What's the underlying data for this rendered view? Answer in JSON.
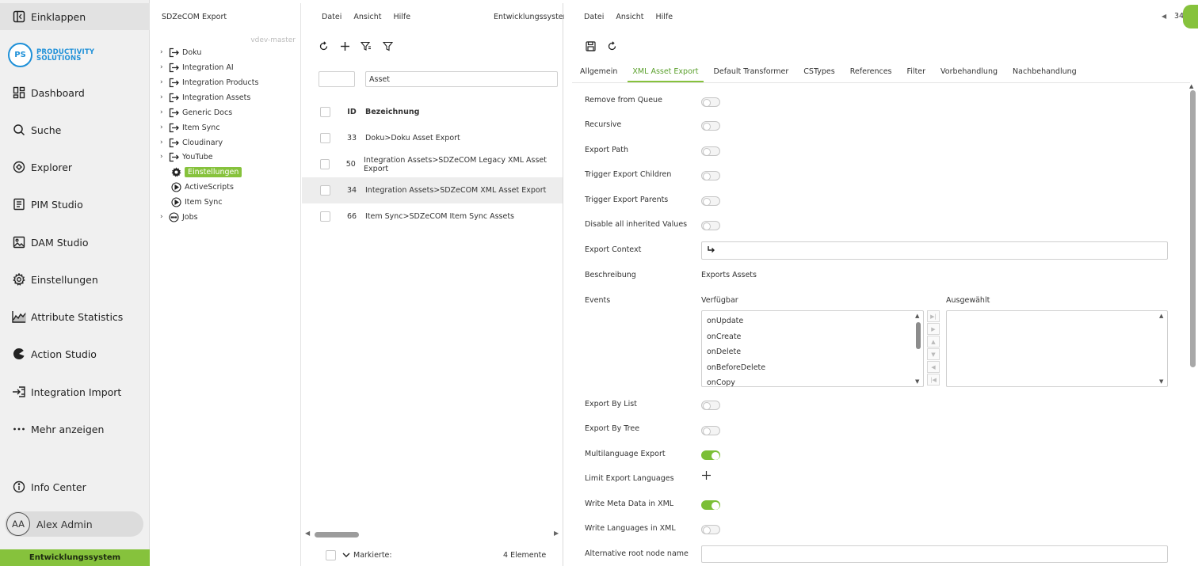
{
  "nav": {
    "collapse": "Einklappen",
    "logo_mark": "PS",
    "logo_line1": "PRODUCTIVITY",
    "logo_line2": "SOLUTIONS",
    "items": [
      "Dashboard",
      "Suche",
      "Explorer",
      "PIM Studio",
      "DAM Studio",
      "Einstellungen",
      "Attribute Statistics",
      "Action Studio",
      "Integration Import",
      "Mehr anzeigen"
    ],
    "info_center": "Info Center",
    "user_initials": "AA",
    "user_name": "Alex Admin",
    "env": "Entwicklungssystem"
  },
  "tree": {
    "title": "SDZeCOM Export",
    "branch": "vdev-master",
    "items": [
      "Doku",
      "Integration AI",
      "Integration Products",
      "Integration Assets",
      "Generic Docs",
      "Item Sync",
      "Cloudinary",
      "YouTube"
    ],
    "children": [
      "Einstellungen",
      "ActiveScripts",
      "Item Sync"
    ],
    "jobs": "Jobs"
  },
  "list": {
    "menu": [
      "Datei",
      "Ansicht",
      "Hilfe"
    ],
    "env": "Entwicklungssystem",
    "search_value": "Asset",
    "col_id": "ID",
    "col_name": "Bezeichnung",
    "rows": [
      {
        "id": "33",
        "name": "Doku>Doku Asset Export"
      },
      {
        "id": "50",
        "name": "Integration Assets>SDZeCOM Legacy XML Asset Export"
      },
      {
        "id": "34",
        "name": "Integration Assets>SDZeCOM XML Asset Export"
      },
      {
        "id": "66",
        "name": "Item Sync>SDZeCOM Item Sync Assets"
      }
    ],
    "footer_label": "Markierte:",
    "footer_count": "4 Elemente"
  },
  "detail": {
    "menu": [
      "Datei",
      "Ansicht",
      "Hilfe"
    ],
    "record_id": "34",
    "tabs": [
      "Allgemein",
      "XML Asset Export",
      "Default Transformer",
      "CSTypes",
      "References",
      "Filter",
      "Vorbehandlung",
      "Nachbehandlung"
    ],
    "fields": {
      "remove_from_queue": "Remove from Queue",
      "recursive": "Recursive",
      "export_path": "Export Path",
      "trigger_children": "Trigger Export Children",
      "trigger_parents": "Trigger Export Parents",
      "disable_inherited": "Disable all inherited Values",
      "export_context": "Export Context",
      "beschreibung": "Beschreibung",
      "beschreibung_value": "Exports Assets",
      "events": "Events",
      "available": "Verfügbar",
      "selected": "Ausgewählt",
      "export_by_list": "Export By List",
      "export_by_tree": "Export By Tree",
      "multilanguage": "Multilanguage Export",
      "limit_languages": "Limit Export Languages",
      "write_meta": "Write Meta Data in XML",
      "write_languages": "Write Languages in XML",
      "alt_root": "Alternative root node name"
    },
    "event_options": [
      "onUpdate",
      "onCreate",
      "onDelete",
      "onBeforeDelete",
      "onCopy"
    ],
    "toggles": {
      "remove_from_queue": false,
      "recursive": false,
      "export_path": false,
      "trigger_children": false,
      "trigger_parents": false,
      "disable_inherited": false,
      "export_by_list": false,
      "export_by_tree": false,
      "multilanguage": true,
      "write_meta": true,
      "write_languages": false
    }
  },
  "colors": {
    "accent": "#86c23c",
    "brand": "#1e90d8"
  }
}
